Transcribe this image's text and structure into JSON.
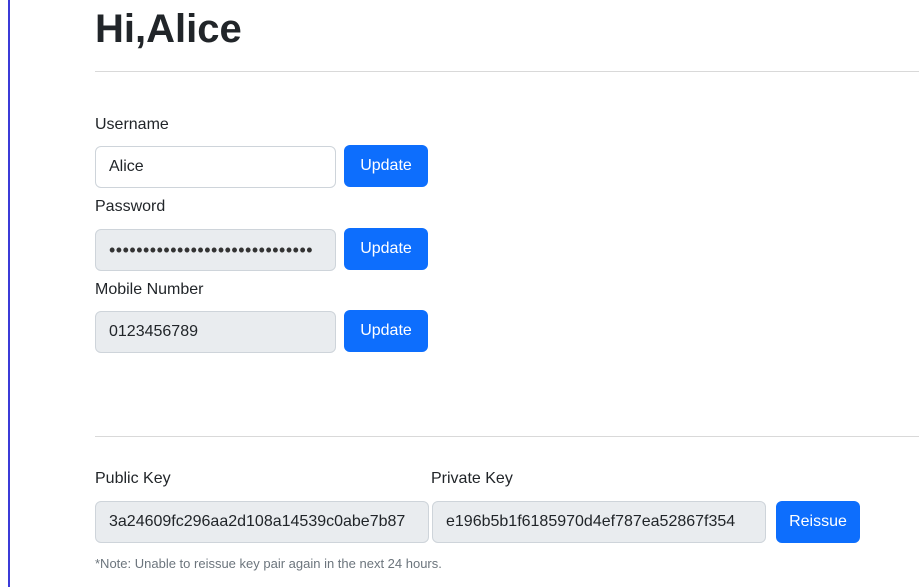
{
  "page": {
    "greeting": "Hi,Alice"
  },
  "account": {
    "username": {
      "label": "Username",
      "value": "Alice",
      "button": "Update"
    },
    "password": {
      "label": "Password",
      "value": "••••••••••••••••••••••••••••••",
      "button": "Update"
    },
    "mobile": {
      "label": "Mobile Number",
      "value": "0123456789",
      "button": "Update"
    }
  },
  "keys": {
    "public": {
      "label": "Public Key",
      "value": "3a24609fc296aa2d108a14539c0abe7b87"
    },
    "private": {
      "label": "Private Key",
      "value": "e196b5b1f6185970d4ef787ea52867f354"
    },
    "reissue_button": "Reissue",
    "note": "*Note: Unable to reissue key pair again in the next 24 hours."
  },
  "colors": {
    "primary": "#0d6efd",
    "disabled_bg": "#e9ecef",
    "border": "#ced4da",
    "muted": "#6c757d",
    "left_border": "#3b3bd8"
  }
}
